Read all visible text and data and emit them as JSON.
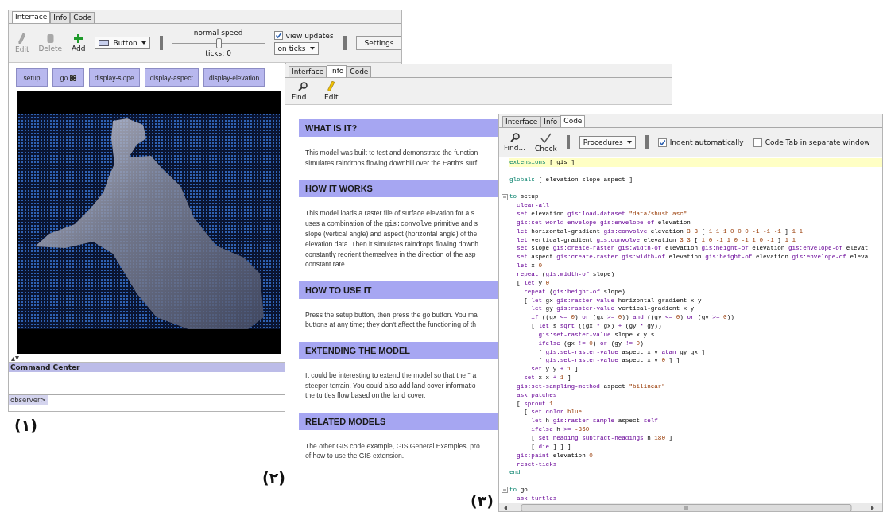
{
  "interface_window": {
    "tabs": [
      {
        "label": "Interface",
        "selected": true
      },
      {
        "label": "Info",
        "selected": false
      },
      {
        "label": "Code",
        "selected": false
      }
    ],
    "tools": [
      {
        "label": "Edit",
        "kind": "edit",
        "disabled": true
      },
      {
        "label": "Delete",
        "kind": "delete",
        "disabled": true
      },
      {
        "label": "Add",
        "kind": "add",
        "disabled": false
      }
    ],
    "widget_chooser": "Button",
    "speed_slider": {
      "label": "normal speed",
      "level": 0.5
    },
    "ticks": "ticks: 0",
    "view_updates": {
      "label": "view updates",
      "checked": true
    },
    "update_mode": "on ticks",
    "settings_button": "Settings...",
    "buttons": [
      {
        "label": "setup",
        "forever": false
      },
      {
        "label": "go",
        "forever": true
      },
      {
        "label": "display-slope",
        "forever": false
      },
      {
        "label": "display-aspect",
        "forever": false
      },
      {
        "label": "display-elevation",
        "forever": false
      }
    ],
    "command_center": {
      "title": "Command Center",
      "prompt": "observer>"
    }
  },
  "info_window": {
    "tabs": [
      {
        "label": "Interface",
        "selected": false
      },
      {
        "label": "Info",
        "selected": true
      },
      {
        "label": "Code",
        "selected": false
      }
    ],
    "tools": [
      {
        "label": "Find...",
        "kind": "find"
      },
      {
        "label": "Edit",
        "kind": "edit"
      }
    ],
    "sections": [
      {
        "heading": "WHAT IS IT?",
        "lines": [
          "This model was built to test and demonstrate the function",
          "simulates raindrops flowing downhill over the Earth's surf"
        ]
      },
      {
        "heading": "HOW IT WORKS",
        "lines": [
          "This model loads a raster file of surface elevation for a s",
          [
            {
              "kind": "prose",
              "text": "uses a combination of the "
            },
            {
              "kind": "code",
              "text": "gis:convolve"
            },
            {
              "kind": "prose",
              "text": " primitive and s"
            }
          ],
          "slope (vertical angle) and aspect (horizontal angle) of the",
          "elevation data. Then it simulates raindrops flowing downh",
          "constantly reorient themselves in the direction of the asp",
          "constant rate."
        ]
      },
      {
        "heading": "HOW TO USE IT",
        "lines": [
          "Press the setup button, then press the go button. You ma",
          "buttons at any time; they don't affect the functioning of th"
        ]
      },
      {
        "heading": "EXTENDING THE MODEL",
        "lines": [
          "It could be interesting to extend the model so that the \"ra",
          "steeper terrain. You could also add land cover informatio",
          "the turtles flow based on the land cover."
        ]
      },
      {
        "heading": "RELATED MODELS",
        "lines": [
          "The other GIS code example, GIS General Examples, pro",
          "of how to use the GIS extension."
        ]
      }
    ]
  },
  "code_window": {
    "tabs": [
      {
        "label": "Interface",
        "selected": false
      },
      {
        "label": "Info",
        "selected": false
      },
      {
        "label": "Code",
        "selected": true
      }
    ],
    "tools": [
      {
        "label": "Find...",
        "kind": "find"
      },
      {
        "label": "Check",
        "kind": "check"
      }
    ],
    "procedures_menu": "Procedures",
    "indent_checkbox": {
      "label": "Indent automatically",
      "checked": true
    },
    "separate_window_checkbox": {
      "label": "Code Tab in separate window",
      "checked": false
    },
    "code_lines": [
      {
        "kind": "code",
        "foldable": false,
        "current": true,
        "segments": [
          {
            "kind": "keyword",
            "text": "extensions"
          },
          {
            "kind": "plain",
            "text": " [ gis ]"
          }
        ]
      },
      {
        "kind": "blank"
      },
      {
        "kind": "code",
        "foldable": false,
        "current": false,
        "segments": [
          {
            "kind": "keyword",
            "text": "globals"
          },
          {
            "kind": "plain",
            "text": " [ elevation slope aspect ]"
          }
        ]
      },
      {
        "kind": "blank"
      },
      {
        "kind": "code",
        "foldable": true,
        "current": false,
        "segments": [
          {
            "kind": "keyword",
            "text": "to"
          },
          {
            "kind": "plain",
            "text": " setup"
          }
        ]
      },
      {
        "kind": "code",
        "foldable": false,
        "current": false,
        "segments": [
          {
            "kind": "primitive",
            "text": "  clear-all"
          }
        ]
      },
      {
        "kind": "code",
        "foldable": false,
        "current": false,
        "segments": [
          {
            "kind": "primitive",
            "text": "  set"
          },
          {
            "kind": "plain",
            "text": " elevation "
          },
          {
            "kind": "primitive",
            "text": "gis:load-dataset"
          },
          {
            "kind": "constant",
            "text": " \"data/shush.asc\""
          }
        ]
      },
      {
        "kind": "code",
        "foldable": false,
        "current": false,
        "segments": [
          {
            "kind": "primitive",
            "text": "  gis:set-world-envelope gis:envelope-of"
          },
          {
            "kind": "plain",
            "text": " elevation"
          }
        ]
      },
      {
        "kind": "code",
        "foldable": false,
        "current": false,
        "segments": [
          {
            "kind": "primitive",
            "text": "  let"
          },
          {
            "kind": "plain",
            "text": " horizontal-gradient "
          },
          {
            "kind": "primitive",
            "text": "gis:convolve"
          },
          {
            "kind": "plain",
            "text": " elevation "
          },
          {
            "kind": "constant",
            "text": "3 3"
          },
          {
            "kind": "plain",
            "text": " [ "
          },
          {
            "kind": "constant",
            "text": "1 1 1 0 0 0 -1 -1 -1"
          },
          {
            "kind": "plain",
            "text": " ] "
          },
          {
            "kind": "constant",
            "text": "1 1"
          }
        ]
      },
      {
        "kind": "code",
        "foldable": false,
        "current": false,
        "segments": [
          {
            "kind": "primitive",
            "text": "  let"
          },
          {
            "kind": "plain",
            "text": " vertical-gradient "
          },
          {
            "kind": "primitive",
            "text": "gis:convolve"
          },
          {
            "kind": "plain",
            "text": " elevation "
          },
          {
            "kind": "constant",
            "text": "3 3"
          },
          {
            "kind": "plain",
            "text": " [ "
          },
          {
            "kind": "constant",
            "text": "1 0 -1 1 0 -1 1 0 -1"
          },
          {
            "kind": "plain",
            "text": " ] "
          },
          {
            "kind": "constant",
            "text": "1 1"
          }
        ]
      },
      {
        "kind": "code",
        "foldable": false,
        "current": false,
        "segments": [
          {
            "kind": "primitive",
            "text": "  set"
          },
          {
            "kind": "plain",
            "text": " slope "
          },
          {
            "kind": "primitive",
            "text": "gis:create-raster gis:width-of"
          },
          {
            "kind": "plain",
            "text": " elevation "
          },
          {
            "kind": "primitive",
            "text": "gis:height-of"
          },
          {
            "kind": "plain",
            "text": " elevation "
          },
          {
            "kind": "primitive",
            "text": "gis:envelope-of"
          },
          {
            "kind": "plain",
            "text": " elevat"
          }
        ]
      },
      {
        "kind": "code",
        "foldable": false,
        "current": false,
        "segments": [
          {
            "kind": "primitive",
            "text": "  set"
          },
          {
            "kind": "plain",
            "text": " aspect "
          },
          {
            "kind": "primitive",
            "text": "gis:create-raster gis:width-of"
          },
          {
            "kind": "plain",
            "text": " elevation "
          },
          {
            "kind": "primitive",
            "text": "gis:height-of"
          },
          {
            "kind": "plain",
            "text": " elevation "
          },
          {
            "kind": "primitive",
            "text": "gis:envelope-of"
          },
          {
            "kind": "plain",
            "text": " eleva"
          }
        ]
      },
      {
        "kind": "code",
        "foldable": false,
        "current": false,
        "segments": [
          {
            "kind": "primitive",
            "text": "  let"
          },
          {
            "kind": "plain",
            "text": " x "
          },
          {
            "kind": "constant",
            "text": "0"
          }
        ]
      },
      {
        "kind": "code",
        "foldable": false,
        "current": false,
        "segments": [
          {
            "kind": "primitive",
            "text": "  repeat"
          },
          {
            "kind": "plain",
            "text": " ("
          },
          {
            "kind": "primitive",
            "text": "gis:width-of"
          },
          {
            "kind": "plain",
            "text": " slope)"
          }
        ]
      },
      {
        "kind": "code",
        "foldable": false,
        "current": false,
        "segments": [
          {
            "kind": "plain",
            "text": "  [ "
          },
          {
            "kind": "primitive",
            "text": "let"
          },
          {
            "kind": "plain",
            "text": " y "
          },
          {
            "kind": "constant",
            "text": "0"
          }
        ]
      },
      {
        "kind": "code",
        "foldable": false,
        "current": false,
        "segments": [
          {
            "kind": "primitive",
            "text": "    repeat"
          },
          {
            "kind": "plain",
            "text": " ("
          },
          {
            "kind": "primitive",
            "text": "gis:height-of"
          },
          {
            "kind": "plain",
            "text": " slope)"
          }
        ]
      },
      {
        "kind": "code",
        "foldable": false,
        "current": false,
        "segments": [
          {
            "kind": "plain",
            "text": "    [ "
          },
          {
            "kind": "primitive",
            "text": "let"
          },
          {
            "kind": "plain",
            "text": " gx "
          },
          {
            "kind": "primitive",
            "text": "gis:raster-value"
          },
          {
            "kind": "plain",
            "text": " horizontal-gradient x y"
          }
        ]
      },
      {
        "kind": "code",
        "foldable": false,
        "current": false,
        "segments": [
          {
            "kind": "primitive",
            "text": "      let"
          },
          {
            "kind": "plain",
            "text": " gy "
          },
          {
            "kind": "primitive",
            "text": "gis:raster-value"
          },
          {
            "kind": "plain",
            "text": " vertical-gradient x y"
          }
        ]
      },
      {
        "kind": "code",
        "foldable": false,
        "current": false,
        "segments": [
          {
            "kind": "primitive",
            "text": "      if"
          },
          {
            "kind": "plain",
            "text": " ((gx "
          },
          {
            "kind": "primitive",
            "text": "<="
          },
          {
            "kind": "constant",
            "text": " 0"
          },
          {
            "kind": "plain",
            "text": ") "
          },
          {
            "kind": "primitive",
            "text": "or"
          },
          {
            "kind": "plain",
            "text": " (gx "
          },
          {
            "kind": "primitive",
            "text": ">="
          },
          {
            "kind": "constant",
            "text": " 0"
          },
          {
            "kind": "plain",
            "text": ")) "
          },
          {
            "kind": "primitive",
            "text": "and"
          },
          {
            "kind": "plain",
            "text": " ((gy "
          },
          {
            "kind": "primitive",
            "text": "<="
          },
          {
            "kind": "constant",
            "text": " 0"
          },
          {
            "kind": "plain",
            "text": ") "
          },
          {
            "kind": "primitive",
            "text": "or"
          },
          {
            "kind": "plain",
            "text": " (gy "
          },
          {
            "kind": "primitive",
            "text": ">="
          },
          {
            "kind": "constant",
            "text": " 0"
          },
          {
            "kind": "plain",
            "text": "))"
          }
        ]
      },
      {
        "kind": "code",
        "foldable": false,
        "current": false,
        "segments": [
          {
            "kind": "plain",
            "text": "      [ "
          },
          {
            "kind": "primitive",
            "text": "let"
          },
          {
            "kind": "plain",
            "text": " s "
          },
          {
            "kind": "primitive",
            "text": "sqrt"
          },
          {
            "kind": "plain",
            "text": " ((gx "
          },
          {
            "kind": "primitive",
            "text": "*"
          },
          {
            "kind": "plain",
            "text": " gx) "
          },
          {
            "kind": "primitive",
            "text": "+"
          },
          {
            "kind": "plain",
            "text": " (gy "
          },
          {
            "kind": "primitive",
            "text": "*"
          },
          {
            "kind": "plain",
            "text": " gy))"
          }
        ]
      },
      {
        "kind": "code",
        "foldable": false,
        "current": false,
        "segments": [
          {
            "kind": "primitive",
            "text": "        gis:set-raster-value"
          },
          {
            "kind": "plain",
            "text": " slope x y s"
          }
        ]
      },
      {
        "kind": "code",
        "foldable": false,
        "current": false,
        "segments": [
          {
            "kind": "primitive",
            "text": "        ifelse"
          },
          {
            "kind": "plain",
            "text": " (gx "
          },
          {
            "kind": "primitive",
            "text": "!="
          },
          {
            "kind": "constant",
            "text": " 0"
          },
          {
            "kind": "plain",
            "text": ") "
          },
          {
            "kind": "primitive",
            "text": "or"
          },
          {
            "kind": "plain",
            "text": " (gy "
          },
          {
            "kind": "primitive",
            "text": "!="
          },
          {
            "kind": "constant",
            "text": " 0"
          },
          {
            "kind": "plain",
            "text": ")"
          }
        ]
      },
      {
        "kind": "code",
        "foldable": false,
        "current": false,
        "segments": [
          {
            "kind": "plain",
            "text": "        [ "
          },
          {
            "kind": "primitive",
            "text": "gis:set-raster-value"
          },
          {
            "kind": "plain",
            "text": " aspect x y "
          },
          {
            "kind": "primitive",
            "text": "atan"
          },
          {
            "kind": "plain",
            "text": " gy gx ]"
          }
        ]
      },
      {
        "kind": "code",
        "foldable": false,
        "current": false,
        "segments": [
          {
            "kind": "plain",
            "text": "        [ "
          },
          {
            "kind": "primitive",
            "text": "gis:set-raster-value"
          },
          {
            "kind": "plain",
            "text": " aspect x y "
          },
          {
            "kind": "constant",
            "text": "0"
          },
          {
            "kind": "plain",
            "text": " ] ]"
          }
        ]
      },
      {
        "kind": "code",
        "foldable": false,
        "current": false,
        "segments": [
          {
            "kind": "primitive",
            "text": "      set"
          },
          {
            "kind": "plain",
            "text": " y y "
          },
          {
            "kind": "primitive",
            "text": "+"
          },
          {
            "kind": "constant",
            "text": " 1"
          },
          {
            "kind": "plain",
            "text": " ]"
          }
        ]
      },
      {
        "kind": "code",
        "foldable": false,
        "current": false,
        "segments": [
          {
            "kind": "primitive",
            "text": "    set"
          },
          {
            "kind": "plain",
            "text": " x x "
          },
          {
            "kind": "primitive",
            "text": "+"
          },
          {
            "kind": "constant",
            "text": " 1"
          },
          {
            "kind": "plain",
            "text": " ]"
          }
        ]
      },
      {
        "kind": "code",
        "foldable": false,
        "current": false,
        "segments": [
          {
            "kind": "primitive",
            "text": "  gis:set-sampling-method"
          },
          {
            "kind": "plain",
            "text": " aspect "
          },
          {
            "kind": "constant",
            "text": "\"bilinear\""
          }
        ]
      },
      {
        "kind": "code",
        "foldable": false,
        "current": false,
        "segments": [
          {
            "kind": "primitive",
            "text": "  ask patches"
          }
        ]
      },
      {
        "kind": "code",
        "foldable": false,
        "current": false,
        "segments": [
          {
            "kind": "plain",
            "text": "  [ "
          },
          {
            "kind": "primitive",
            "text": "sprout"
          },
          {
            "kind": "constant",
            "text": " 1"
          }
        ]
      },
      {
        "kind": "code",
        "foldable": false,
        "current": false,
        "segments": [
          {
            "kind": "plain",
            "text": "    [ "
          },
          {
            "kind": "primitive",
            "text": "set color"
          },
          {
            "kind": "constant",
            "text": " blue"
          }
        ]
      },
      {
        "kind": "code",
        "foldable": false,
        "current": false,
        "segments": [
          {
            "kind": "primitive",
            "text": "      let"
          },
          {
            "kind": "plain",
            "text": " h "
          },
          {
            "kind": "primitive",
            "text": "gis:raster-sample"
          },
          {
            "kind": "plain",
            "text": " aspect "
          },
          {
            "kind": "primitive",
            "text": "self"
          }
        ]
      },
      {
        "kind": "code",
        "foldable": false,
        "current": false,
        "segments": [
          {
            "kind": "primitive",
            "text": "      ifelse"
          },
          {
            "kind": "plain",
            "text": " h "
          },
          {
            "kind": "primitive",
            "text": ">="
          },
          {
            "kind": "constant",
            "text": " -360"
          }
        ]
      },
      {
        "kind": "code",
        "foldable": false,
        "current": false,
        "segments": [
          {
            "kind": "plain",
            "text": "      [ "
          },
          {
            "kind": "primitive",
            "text": "set heading subtract-headings"
          },
          {
            "kind": "plain",
            "text": " h "
          },
          {
            "kind": "constant",
            "text": "180"
          },
          {
            "kind": "plain",
            "text": " ]"
          }
        ]
      },
      {
        "kind": "code",
        "foldable": false,
        "current": false,
        "segments": [
          {
            "kind": "plain",
            "text": "      [ "
          },
          {
            "kind": "primitive",
            "text": "die"
          },
          {
            "kind": "plain",
            "text": " ] ] ]"
          }
        ]
      },
      {
        "kind": "code",
        "foldable": false,
        "current": false,
        "segments": [
          {
            "kind": "primitive",
            "text": "  gis:paint"
          },
          {
            "kind": "plain",
            "text": " elevation "
          },
          {
            "kind": "constant",
            "text": "0"
          }
        ]
      },
      {
        "kind": "code",
        "foldable": false,
        "current": false,
        "segments": [
          {
            "kind": "primitive",
            "text": "  reset-ticks"
          }
        ]
      },
      {
        "kind": "code",
        "foldable": false,
        "current": false,
        "segments": [
          {
            "kind": "keyword",
            "text": "end"
          }
        ]
      },
      {
        "kind": "blank"
      },
      {
        "kind": "code",
        "foldable": true,
        "current": false,
        "segments": [
          {
            "kind": "keyword",
            "text": "to"
          },
          {
            "kind": "plain",
            "text": " go"
          }
        ]
      },
      {
        "kind": "code",
        "foldable": false,
        "current": false,
        "segments": [
          {
            "kind": "primitive",
            "text": "  ask turtles"
          }
        ]
      }
    ]
  },
  "figure_labels": [
    "(۱)",
    "(۲)",
    "(۳)"
  ]
}
